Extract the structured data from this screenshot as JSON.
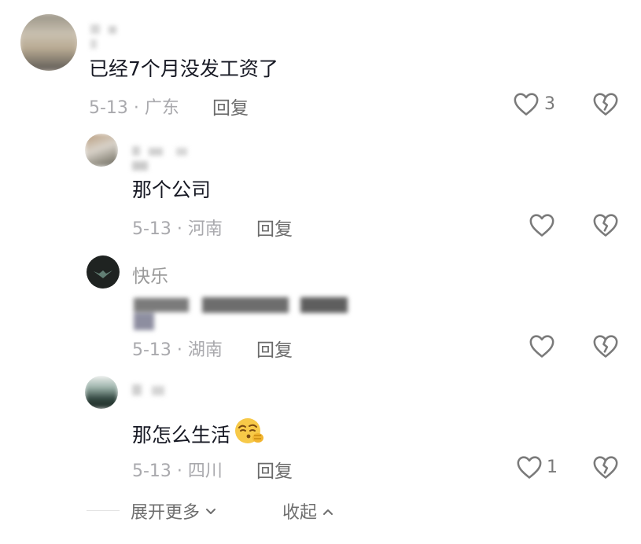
{
  "comment": {
    "text": "已经7个月没发工资了",
    "date_loc": "5-13 · 广东",
    "reply_label": "回复",
    "like_count": "3"
  },
  "replies": [
    {
      "text": "那个公司",
      "date_loc": "5-13 · 河南",
      "reply_label": "回复",
      "like_count": ""
    },
    {
      "username": "快乐",
      "date_loc": "5-13 · 湖南",
      "reply_label": "回复",
      "like_count": ""
    },
    {
      "text": "那怎么生活",
      "date_loc": "5-13 · 四川",
      "reply_label": "回复",
      "like_count": "1"
    }
  ],
  "footer": {
    "expand_label": "展开更多",
    "collapse_label": "收起"
  },
  "icons": {
    "like": "heart-outline-icon",
    "dislike": "broken-heart-icon",
    "emoji": "thinking-face-emoji",
    "expand": "chevron-down-icon",
    "collapse": "chevron-up-icon"
  },
  "colors": {
    "text_primary": "#161823",
    "text_secondary": "#a9a9ad",
    "icon_gray": "#7a7a7a"
  }
}
